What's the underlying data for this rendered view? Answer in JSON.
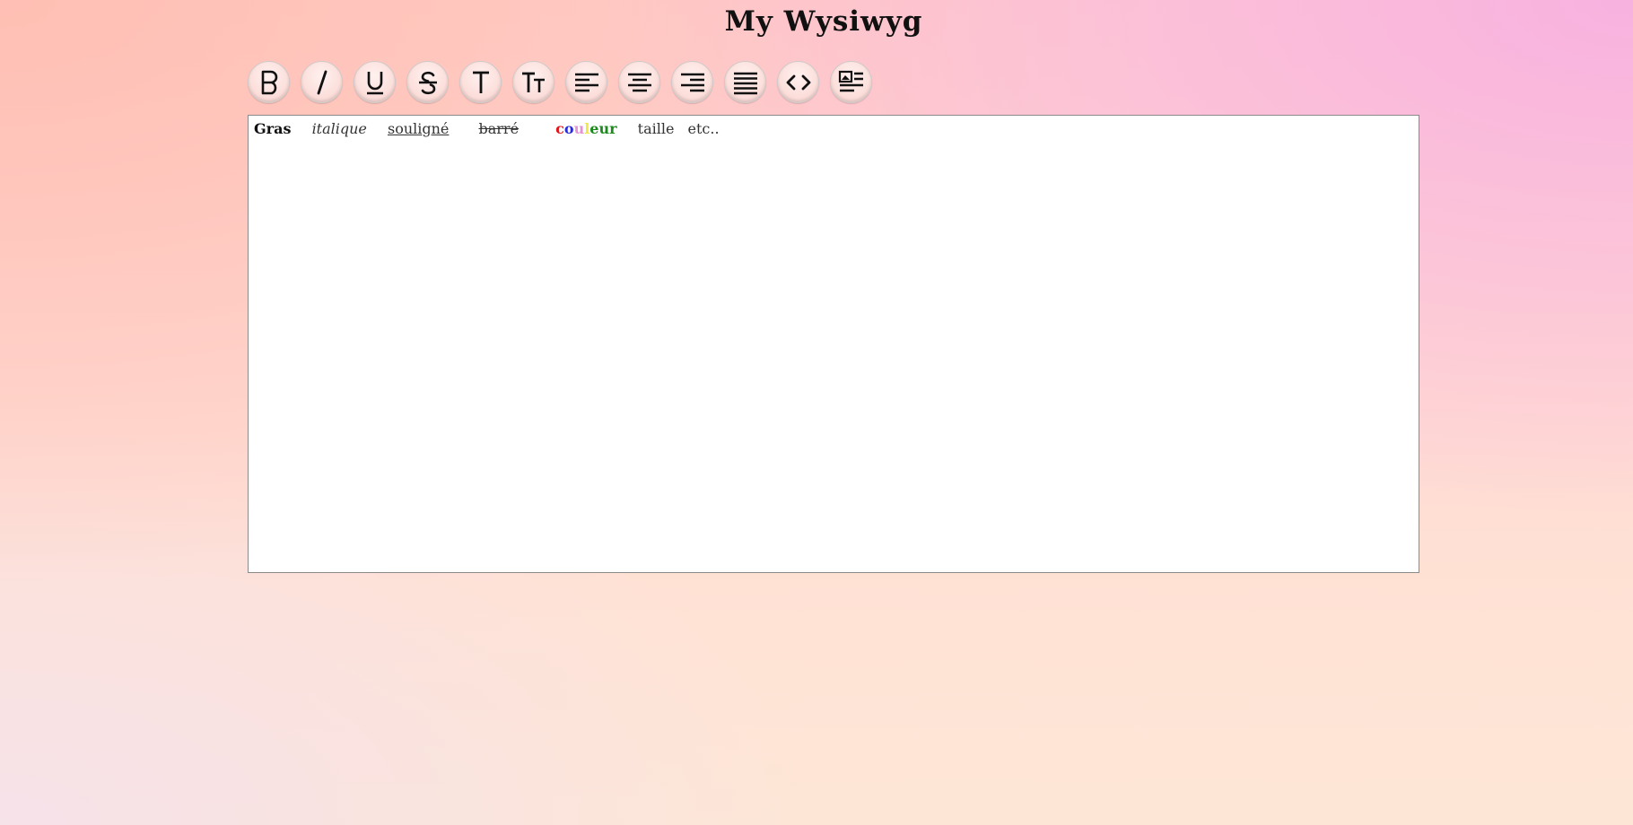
{
  "page": {
    "title": "My Wysiwyg"
  },
  "toolbar": {
    "buttons": [
      {
        "name": "bold",
        "icon": "bold-icon"
      },
      {
        "name": "italic",
        "icon": "italic-icon"
      },
      {
        "name": "underline",
        "icon": "underline-icon"
      },
      {
        "name": "strikethrough",
        "icon": "strikethrough-icon"
      },
      {
        "name": "text",
        "icon": "text-icon"
      },
      {
        "name": "font-size",
        "icon": "font-size-icon"
      },
      {
        "name": "align-left",
        "icon": "align-left-icon"
      },
      {
        "name": "align-center",
        "icon": "align-center-icon"
      },
      {
        "name": "align-right",
        "icon": "align-right-icon"
      },
      {
        "name": "align-justify",
        "icon": "align-justify-icon"
      },
      {
        "name": "code",
        "icon": "code-icon"
      },
      {
        "name": "image-text",
        "icon": "image-text-icon"
      }
    ]
  },
  "editor": {
    "bold": "Gras",
    "italic": "italique",
    "underline": "souligné",
    "strike": "barré",
    "color_letters": [
      {
        "char": "c",
        "color": "#e0161b"
      },
      {
        "char": "o",
        "color": "#2a2ad8"
      },
      {
        "char": "u",
        "color": "#e592d6"
      },
      {
        "char": "l",
        "color": "#f0e84a"
      },
      {
        "char": "e",
        "color": "#1c8a1c"
      },
      {
        "char": "u",
        "color": "#1c8a1c"
      },
      {
        "char": "r",
        "color": "#1c8a1c"
      }
    ],
    "size": "taille",
    "etc": "etc.."
  }
}
